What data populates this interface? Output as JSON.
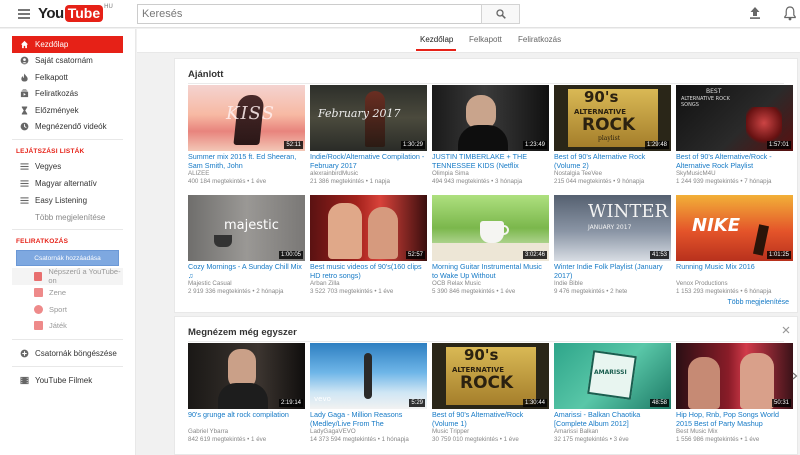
{
  "header": {
    "logo_you": "You",
    "logo_tube": "Tube",
    "logo_region": "HU",
    "search_placeholder": "Keresés"
  },
  "sidebar": {
    "items": [
      {
        "label": "Kezdőlap",
        "icon": "home-icon"
      },
      {
        "label": "Saját csatornám",
        "icon": "person-icon"
      },
      {
        "label": "Felkapott",
        "icon": "flame-icon"
      },
      {
        "label": "Feliratkozás",
        "icon": "subscriptions-icon"
      },
      {
        "label": "Előzmények",
        "icon": "hourglass-icon"
      },
      {
        "label": "Megnézendő videók",
        "icon": "clock-icon"
      }
    ],
    "playlists_title": "LEJÁTSZÁSI LISTÁK",
    "playlists": [
      "Vegyes",
      "Magyar alternatív",
      "Easy Listening"
    ],
    "more_label": "Több megjelenítése",
    "subs_title": "FELIRATKOZÁS",
    "add_channels_label": "Csatornák hozzáadása",
    "subs": [
      "Népszerű a YouTube-on",
      "Zene",
      "Sport",
      "Játék"
    ],
    "browse_label": "Csatornák böngészése",
    "films_label": "YouTube Filmek"
  },
  "tabs": [
    "Kezdőlap",
    "Felkapott",
    "Feliratkozás"
  ],
  "recommended": {
    "title": "Ajánlott",
    "more_label": "Több megjelenítése",
    "videos": [
      {
        "title": "Summer mix 2015 ft. Ed Sheeran, Sam Smith, John",
        "channel": "ALIZEE",
        "meta": "400 184 megtekintés • 1 éve",
        "duration": "52:11"
      },
      {
        "title": "Indie/Rock/Alternative Compilation - February 2017",
        "channel": "alexrainbirdMusic",
        "meta": "21 386 megtekintés • 1 napja",
        "duration": "1:30:29"
      },
      {
        "title": "JUSTIN TIMBERLAKE + THE TENNESSEE KIDS (Netflix",
        "channel": "Olimpia Sima",
        "meta": "494 943 megtekintés • 3 hónapja",
        "duration": "1:23:49"
      },
      {
        "title": "Best of 90's Alternative Rock (Volume 2)",
        "channel": "Nostalgia TeeVee",
        "meta": "215 044 megtekintés • 9 hónapja",
        "duration": "1:29:48"
      },
      {
        "title": "Best of 90's Alternative/Rock - Alternative Rock Playlist",
        "channel": "SkyMusicM4U",
        "meta": "1 244 939 megtekintés • 7 hónapja",
        "duration": "1:57:01"
      },
      {
        "title": "Cozy Mornings - A Sunday Chill Mix ♫",
        "channel": "Majestic Casual",
        "meta": "2 919 336 megtekintés • 2 hónapja",
        "duration": "1:00:05"
      },
      {
        "title": "Best music videos of 90's(160 clips HD retro songs)",
        "channel": "Arban Zilla",
        "meta": "3 522 703 megtekintés • 1 éve",
        "duration": "52:57"
      },
      {
        "title": "Morning Guitar Instrumental Music to Wake Up Without",
        "channel": "OCB Relax Music",
        "meta": "5 390 846 megtekintés • 1 éve",
        "duration": "3:02:46"
      },
      {
        "title": "Winter Indie Folk Playlist (January 2017)",
        "channel": "Indie Bible",
        "meta": "9 476 megtekintés • 2 hete",
        "duration": "41:53"
      },
      {
        "title": "Running Music Mix 2016",
        "channel": "Venox Productions",
        "meta": "1 153 293 megtekintés • 6 hónapja",
        "duration": "1:01:25"
      }
    ]
  },
  "rewatch": {
    "title": "Megnézem még egyszer",
    "videos": [
      {
        "title": "90's grunge alt rock compilation",
        "channel": "Gabriel Ybarra",
        "meta": "842 619 megtekintés • 1 éve",
        "duration": "2:19:14"
      },
      {
        "title": "Lady Gaga - Million Reasons (Medley/Live From The",
        "channel": "LadyGagaVEVO",
        "meta": "14 373 594 megtekintés • 1 hónapja",
        "duration": "5:29"
      },
      {
        "title": "Best of 90's Alternative/Rock (Volume 1)",
        "channel": "Music Tripper",
        "meta": "30 759 010 megtekintés • 1 éve",
        "duration": "1:30:44"
      },
      {
        "title": "Amarissi - Balkan Chaotika [Complete Album 2012]",
        "channel": "Amarissi Balkan",
        "meta": "32 175 megtekintés • 3 éve",
        "duration": "48:58"
      },
      {
        "title": "Hip Hop, Rnb, Pop Songs World 2015 Best of Party Mashup",
        "channel": "Best Music Mix",
        "meta": "1 556 986 megtekintés • 1 éve",
        "duration": "50:31"
      }
    ]
  },
  "thumb_text": {
    "kiss": "KISS",
    "february": "February 2017",
    "rock90": "90's",
    "alternative": "ALTERNATIVE",
    "rock": "ROCK",
    "playlist": "playlist",
    "best": "BEST",
    "alt_rock_songs": "ALTERNATIVE ROCK SONGS",
    "majestic": "majestic",
    "winter": "WINTER",
    "january": "JANUARY 2017",
    "nike": "NIKE",
    "vevo": "vevo",
    "amarissi": "AMARISSI"
  },
  "colors": {
    "brand_red": "#e62117",
    "link_blue": "#167ac6"
  }
}
